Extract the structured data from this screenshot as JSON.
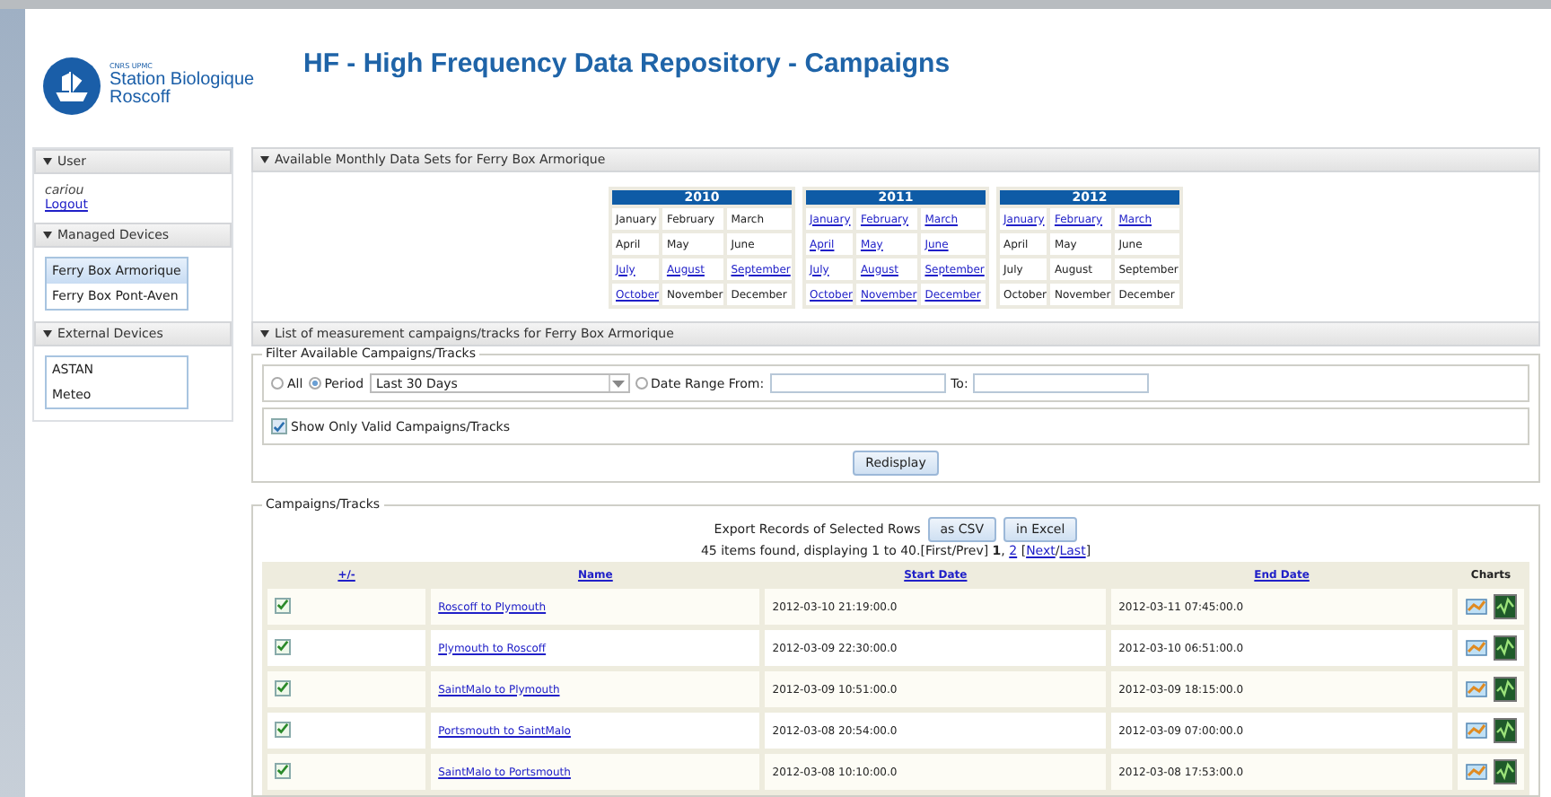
{
  "header": {
    "logo_small": "CNRS UPMC",
    "logo_line1": "Station Biologique",
    "logo_line2": "Roscoff",
    "title": "HF - High Frequency Data Repository - Campaigns"
  },
  "sidebar": [
    {
      "title": "User",
      "kind": "user",
      "user": "cariou",
      "link": "Logout"
    },
    {
      "title": "Managed Devices",
      "kind": "list",
      "items": [
        {
          "label": "Ferry Box Armorique",
          "selected": true
        },
        {
          "label": "Ferry Box Pont-Aven",
          "selected": false
        }
      ]
    },
    {
      "title": "External Devices",
      "kind": "list",
      "items": [
        {
          "label": "ASTAN",
          "selected": false
        },
        {
          "label": "Meteo",
          "selected": false
        }
      ]
    }
  ],
  "monthly": {
    "title": "Available Monthly Data Sets for Ferry Box Armorique",
    "years": [
      {
        "year": "2010",
        "months": [
          {
            "name": "January",
            "available": false
          },
          {
            "name": "February",
            "available": false
          },
          {
            "name": "March",
            "available": false
          },
          {
            "name": "April",
            "available": false
          },
          {
            "name": "May",
            "available": false
          },
          {
            "name": "June",
            "available": false
          },
          {
            "name": "July",
            "available": true
          },
          {
            "name": "August",
            "available": true
          },
          {
            "name": "September",
            "available": true
          },
          {
            "name": "October",
            "available": true
          },
          {
            "name": "November",
            "available": false
          },
          {
            "name": "December",
            "available": false
          }
        ]
      },
      {
        "year": "2011",
        "months": [
          {
            "name": "January",
            "available": true
          },
          {
            "name": "February",
            "available": true
          },
          {
            "name": "March",
            "available": true
          },
          {
            "name": "April",
            "available": true
          },
          {
            "name": "May",
            "available": true
          },
          {
            "name": "June",
            "available": true
          },
          {
            "name": "July",
            "available": true
          },
          {
            "name": "August",
            "available": true
          },
          {
            "name": "September",
            "available": true
          },
          {
            "name": "October",
            "available": true
          },
          {
            "name": "November",
            "available": true
          },
          {
            "name": "December",
            "available": true
          }
        ]
      },
      {
        "year": "2012",
        "months": [
          {
            "name": "January",
            "available": true
          },
          {
            "name": "February",
            "available": true
          },
          {
            "name": "March",
            "available": true
          },
          {
            "name": "April",
            "available": false
          },
          {
            "name": "May",
            "available": false
          },
          {
            "name": "June",
            "available": false
          },
          {
            "name": "July",
            "available": false
          },
          {
            "name": "August",
            "available": false
          },
          {
            "name": "September",
            "available": false
          },
          {
            "name": "October",
            "available": false
          },
          {
            "name": "November",
            "available": false
          },
          {
            "name": "December",
            "available": false
          }
        ]
      }
    ]
  },
  "campaigns": {
    "title": "List of measurement campaigns/tracks for Ferry Box Armorique",
    "filter": {
      "legend": "Filter Available Campaigns/Tracks",
      "radios": [
        {
          "label": "All",
          "selected": false
        },
        {
          "label": "Period",
          "selected": true
        }
      ],
      "period_value": "Last 30 Days",
      "range_radio": {
        "label": "Date Range From:",
        "selected": false
      },
      "to_label": "To:",
      "valid_only": {
        "label": "Show Only Valid Campaigns/Tracks",
        "checked": true
      },
      "button": "Redisplay"
    },
    "table": {
      "legend": "Campaigns/Tracks",
      "export_label": "Export Records of Selected Rows",
      "export_buttons": [
        "as CSV",
        "in Excel"
      ],
      "summary": "45 items found, displaying 1 to 40.[First/Prev] ",
      "current_page": "1",
      "page_sep": ", ",
      "other_page": "2",
      "next_open": " [",
      "next": "Next",
      "slash": "/",
      "last": "Last",
      "next_close": "]",
      "columns": [
        "+/-",
        "Name",
        "Start Date",
        "End Date",
        "Charts"
      ],
      "rows": [
        {
          "checked": true,
          "name": "Roscoff to Plymouth",
          "start": "2012-03-10 21:19:00.0",
          "end": "2012-03-11 07:45:00.0"
        },
        {
          "checked": true,
          "name": "Plymouth to Roscoff",
          "start": "2012-03-09 22:30:00.0",
          "end": "2012-03-10 06:51:00.0"
        },
        {
          "checked": true,
          "name": "SaintMalo to Plymouth",
          "start": "2012-03-09 10:51:00.0",
          "end": "2012-03-09 18:15:00.0"
        },
        {
          "checked": true,
          "name": "Portsmouth to SaintMalo",
          "start": "2012-03-08 20:54:00.0",
          "end": "2012-03-09 07:00:00.0"
        },
        {
          "checked": true,
          "name": "SaintMalo to Portsmouth",
          "start": "2012-03-08 10:10:00.0",
          "end": "2012-03-08 17:53:00.0"
        }
      ]
    }
  }
}
